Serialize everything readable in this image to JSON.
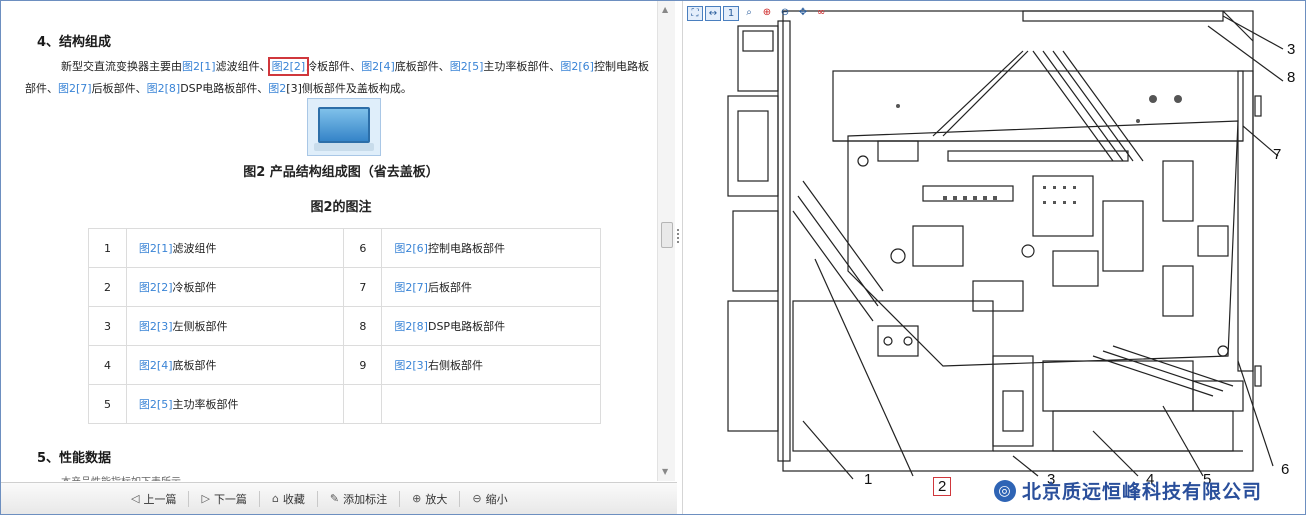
{
  "document": {
    "section4_title": "4、结构组成",
    "intro_prefix": "新型交直流变换器主要由",
    "items": [
      {
        "link": "图2[1]",
        "text": "滤波组件、"
      },
      {
        "link": "图2[2]",
        "text": "冷板部件、"
      },
      {
        "link": "图2[4]",
        "text": "底板部件、"
      },
      {
        "link": "图2[5]",
        "text": "主功率板部件、"
      },
      {
        "link": "图2[6]",
        "text": "控制电路板部件、"
      },
      {
        "link": "图2[7]",
        "text": "后板部件、"
      },
      {
        "link": "图2[8]",
        "text": "DSP电路板部件、"
      },
      {
        "link": "图2",
        "text": "[3]侧板部件及盖板构成。"
      }
    ],
    "figure_caption": "图2 产品结构组成图（省去盖板）",
    "legend_title": "图2的图注",
    "legend_rows": [
      {
        "n1": "1",
        "l1": "图2[1]",
        "t1": "滤波组件",
        "n2": "6",
        "l2": "图2[6]",
        "t2": "控制电路板部件"
      },
      {
        "n1": "2",
        "l1": "图2[2]",
        "t1": "冷板部件",
        "n2": "7",
        "l2": "图2[7]",
        "t2": "后板部件"
      },
      {
        "n1": "3",
        "l1": "图2[3]",
        "t1": "左侧板部件",
        "n2": "8",
        "l2": "图2[8]",
        "t2": "DSP电路板部件"
      },
      {
        "n1": "4",
        "l1": "图2[4]",
        "t1": "底板部件",
        "n2": "9",
        "l2": "图2[3]",
        "t2": "右侧板部件"
      },
      {
        "n1": "5",
        "l1": "图2[5]",
        "t1": "主功率板部件",
        "n2": "",
        "l2": "",
        "t2": ""
      }
    ],
    "section5_title": "5、性能数据",
    "cut_text": "本产品性能指标如下表所示"
  },
  "toolbar": {
    "prev": "上一篇",
    "next": "下一篇",
    "favorite": "收藏",
    "annotate": "添加标注",
    "zoom_in": "放大",
    "zoom_out": "缩小"
  },
  "viewer": {
    "callouts": [
      "1",
      "2",
      "3",
      "4",
      "5",
      "6",
      "7",
      "8",
      "3"
    ],
    "company_name": "北京质远恒峰科技有限公司"
  },
  "colors": {
    "link": "#3a84d6",
    "highlight": "#d0373c",
    "company": "#2a4f9b"
  }
}
